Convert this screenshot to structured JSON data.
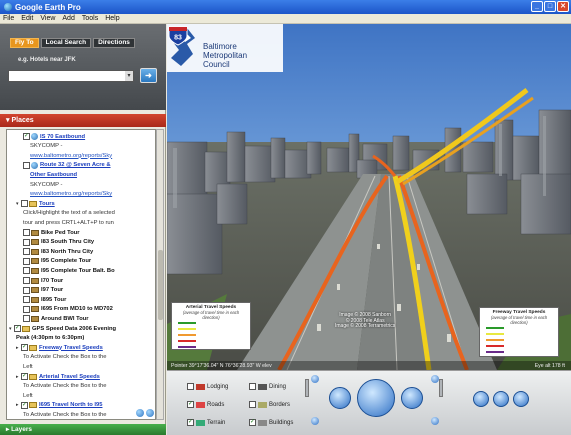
{
  "window": {
    "title": "Google Earth Pro"
  },
  "menu": [
    "File",
    "Edit",
    "View",
    "Add",
    "Tools",
    "Help"
  ],
  "search": {
    "tabs": [
      "Fly To",
      "Local Search",
      "Directions"
    ],
    "hint": "e.g. Hotels near JFK",
    "go_icon": "search-go-icon"
  },
  "places": {
    "header": "Places",
    "items": [
      {
        "level": 2,
        "checked": true,
        "icon": "globe",
        "text": "IS 70 Eastbound",
        "style": "link"
      },
      {
        "level": 3,
        "text": "SKYCOMP -",
        "style": "plain"
      },
      {
        "level": 3,
        "text": "www.baltometro.org/reports/Sky",
        "style": "url"
      },
      {
        "level": 2,
        "checked": false,
        "icon": "globe",
        "text": "Route 32 @ Seven Acre &",
        "style": "link"
      },
      {
        "level": 3,
        "text": "Other Eastbound",
        "style": "link"
      },
      {
        "level": 3,
        "text": "SKYCOMP -",
        "style": "plain"
      },
      {
        "level": 3,
        "text": "www.baltometro.org/reports/Sky",
        "style": "url"
      },
      {
        "level": 1,
        "checked": false,
        "icon": "folder",
        "text": "Tours",
        "style": "link",
        "open": true
      },
      {
        "level": 2,
        "text": "Click/Highlight the text of a selected",
        "style": "plain"
      },
      {
        "level": 2,
        "text": "tour and press CRTL+ALT+P to run",
        "style": "plain"
      },
      {
        "level": 2,
        "checked": false,
        "icon": "tour",
        "text": "Bike Ped Tour",
        "style": "bold"
      },
      {
        "level": 2,
        "checked": false,
        "icon": "tour",
        "text": "I83 South Thru City",
        "style": "bold"
      },
      {
        "level": 2,
        "checked": false,
        "icon": "tour",
        "text": "I83 North Thru City",
        "style": "bold"
      },
      {
        "level": 2,
        "checked": false,
        "icon": "tour",
        "text": "I95 Complete Tour",
        "style": "bold"
      },
      {
        "level": 2,
        "checked": false,
        "icon": "tour",
        "text": "I95 Complete Tour Balt. Bo",
        "style": "bold"
      },
      {
        "level": 2,
        "checked": false,
        "icon": "tour",
        "text": "I70 Tour",
        "style": "bold"
      },
      {
        "level": 2,
        "checked": false,
        "icon": "tour",
        "text": "I97 Tour",
        "style": "bold"
      },
      {
        "level": 2,
        "checked": false,
        "icon": "tour",
        "text": "I895 Tour",
        "style": "bold"
      },
      {
        "level": 2,
        "checked": false,
        "icon": "tour",
        "text": "I695 From MD10 to MD702",
        "style": "bold"
      },
      {
        "level": 2,
        "checked": false,
        "icon": "tour",
        "text": "Around BWI Tour",
        "style": "bold"
      },
      {
        "level": 0,
        "checked": true,
        "icon": "folder",
        "text": "GPS Speed Data 2006 Evening",
        "style": "bold",
        "open": true
      },
      {
        "level": 1,
        "text": "Peak (4:30pm to 6:30pm)",
        "style": "bold"
      },
      {
        "level": 1,
        "checked": true,
        "icon": "folder",
        "text": "Freeway Travel Speeds",
        "style": "link",
        "closed": true
      },
      {
        "level": 2,
        "text": "To Activate Check the Box to the",
        "style": "plain"
      },
      {
        "level": 2,
        "text": "Left",
        "style": "plain"
      },
      {
        "level": 1,
        "checked": true,
        "icon": "folder",
        "text": "Arterial Travel Speeds",
        "style": "link",
        "closed": true
      },
      {
        "level": 2,
        "text": "To Activate Check the Box to the",
        "style": "plain"
      },
      {
        "level": 2,
        "text": "Left",
        "style": "plain"
      },
      {
        "level": 1,
        "checked": true,
        "icon": "folder",
        "text": "I695 Travel North to I95",
        "style": "link",
        "closed": true
      },
      {
        "level": 2,
        "text": "To Activate Check the Box to the",
        "style": "plain"
      }
    ]
  },
  "layers": {
    "header": "Layers"
  },
  "map": {
    "logo_lines": [
      "Baltimore",
      "Metropolitan",
      "Council"
    ],
    "shield_text": "83",
    "credit_lines": [
      "Image © 2008 Sanborn",
      "© 2008 Tele Atlas",
      "Image © 2008 Terrametrics"
    ],
    "status_left": "Pointer 39°17'36.04\" N  76°36'28.93\" W  elev",
    "status_right": "Eye alt    178 ft",
    "legend_left": {
      "title": "Arterial Travel Speeds",
      "subtitle": "(average of travel time in each direction)",
      "rows": [
        {
          "label": "",
          "color": "#2a9a2a"
        },
        {
          "label": "",
          "color": "#e8e840"
        },
        {
          "label": "",
          "color": "#f09a30"
        },
        {
          "label": "",
          "color": "#d82a2a"
        },
        {
          "label": "",
          "color": "#6a2a8a"
        }
      ]
    },
    "legend_right": {
      "title": "Freeway Travel Speeds",
      "subtitle": "(average of travel time in each direction)",
      "rows": [
        {
          "label": "",
          "color": "#2a9a2a"
        },
        {
          "label": "",
          "color": "#e8e840"
        },
        {
          "label": "",
          "color": "#f09a30"
        },
        {
          "label": "",
          "color": "#d82a2a"
        },
        {
          "label": "",
          "color": "#6a2a8a"
        }
      ]
    }
  },
  "bottom_layers": [
    {
      "label": "Lodging",
      "checked": false,
      "color": "#c0392b"
    },
    {
      "label": "Dining",
      "checked": false,
      "color": "#555"
    },
    {
      "label": "Roads",
      "checked": true,
      "color": "#d44"
    },
    {
      "label": "Borders",
      "checked": false,
      "color": "#aa6"
    },
    {
      "label": "Terrain",
      "checked": true,
      "color": "#3a7"
    },
    {
      "label": "Buildings",
      "checked": true,
      "color": "#888"
    }
  ]
}
